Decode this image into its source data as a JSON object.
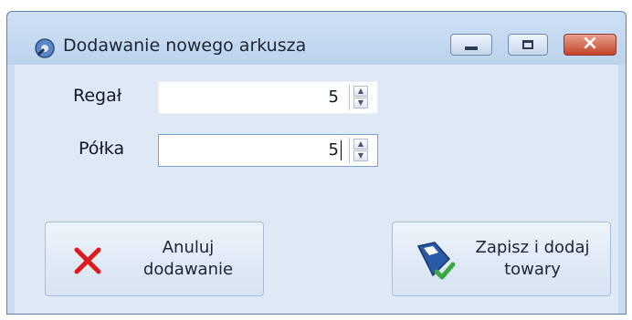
{
  "window": {
    "title": "Dodawanie nowego arkusza",
    "icon": "gear-icon"
  },
  "fields": {
    "regal": {
      "label": "Regał",
      "value": "5"
    },
    "polka": {
      "label": "Półka",
      "value": "5"
    }
  },
  "buttons": {
    "cancel": {
      "line1": "Anuluj",
      "line2": "dodawanie",
      "icon": "x-icon"
    },
    "save": {
      "line1": "Zapisz i dodaj",
      "line2": "towary",
      "icon": "save-icon"
    }
  },
  "colors": {
    "cancel_x": "#e0191b",
    "save_disk": "#2a5aa8",
    "checkmark": "#3aa845"
  }
}
